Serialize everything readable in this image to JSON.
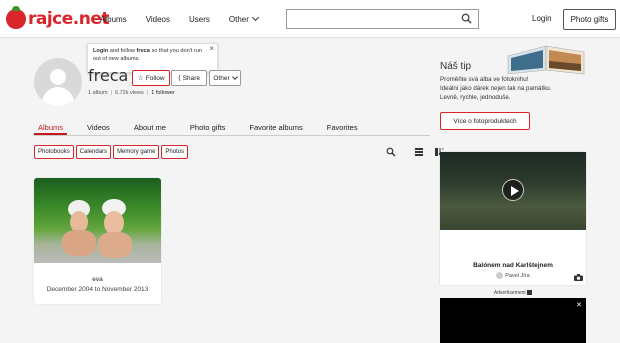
{
  "logo": {
    "text": "rajce.net"
  },
  "nav": {
    "items": [
      "Albums",
      "Videos",
      "Users"
    ],
    "other_label": "Other"
  },
  "search": {
    "value": "",
    "placeholder": ""
  },
  "header": {
    "login_label": "Login",
    "photo_gifts_label": "Photo gifts"
  },
  "tooltip": {
    "bold_login": "Login",
    "text_1": " and follow ",
    "bold_name": "freca",
    "text_2": " so that you don't run out of new albums.",
    "close": "×"
  },
  "profile": {
    "name": "freca",
    "follow_label": "Follow",
    "share_label": "Share",
    "other_label": "Other",
    "stats": {
      "albums": "1 album",
      "views": "6.72k views",
      "followers": "1 follower"
    }
  },
  "tabs": [
    "Albums",
    "Videos",
    "About me",
    "Photo gifts",
    "Favorite albums",
    "Favorites"
  ],
  "active_tab": "Albums",
  "filters": [
    "Photobooks",
    "Calendars",
    "Memory game",
    "Photos"
  ],
  "album": {
    "title": "eva",
    "date": "December 2004 to November 2013"
  },
  "tip": {
    "title": "Náš tip",
    "line1": "Proměňte svá alba ve fotoknihu!",
    "line2": "Ideální jako dárek nejen tak na památku.",
    "line3": "Levně, rychle, jednoduše.",
    "button_label": "Více o fotoproduktech"
  },
  "video": {
    "title": "Balónem nad Karlštejnem",
    "author": "Pavel Jíra"
  },
  "ad": {
    "label": "Advertisement",
    "close": "✕"
  },
  "colors": {
    "brand_red": "#d8262b",
    "active_tab": "#c5191f"
  }
}
